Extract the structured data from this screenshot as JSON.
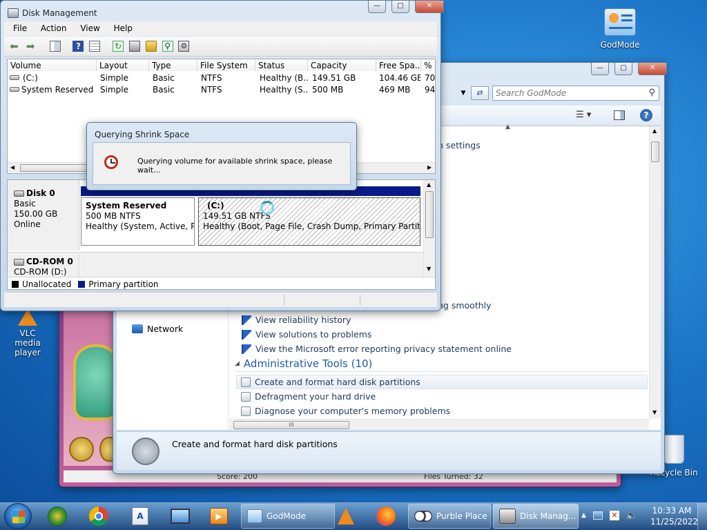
{
  "desktop": {
    "godmode_label": "GodMode",
    "vlc_label": "VLC media player",
    "recycle_label": "Recycle Bin"
  },
  "purble": {
    "score": "Score: 200",
    "turned": "Files Turned: 32"
  },
  "control_panel": {
    "search_placeholder": "Search GodMode",
    "partial_text_1": "n settings",
    "partial_text_2": "ng smoothly",
    "sidebar_network": "Network",
    "links": [
      "View reliability history",
      "View solutions to problems",
      "View the Microsoft error reporting privacy statement online"
    ],
    "section_title": "Administrative Tools (10)",
    "admin_links": [
      "Create and format hard disk partitions",
      "Defragment your hard drive",
      "Diagnose your computer's memory problems"
    ],
    "hscroll_grip": "III",
    "details_text": "Create and format hard disk partitions"
  },
  "disk_mgmt": {
    "title": "Disk Management",
    "menu": [
      "File",
      "Action",
      "View",
      "Help"
    ],
    "columns": [
      "Volume",
      "Layout",
      "Type",
      "File System",
      "Status",
      "Capacity",
      "Free Spa...",
      "% F"
    ],
    "rows": [
      [
        "(C:)",
        "Simple",
        "Basic",
        "NTFS",
        "Healthy (B...",
        "149.51 GB",
        "104.46 GB",
        "70"
      ],
      [
        "System Reserved",
        "Simple",
        "Basic",
        "NTFS",
        "Healthy (S...",
        "500 MB",
        "469 MB",
        "94"
      ]
    ],
    "disk0": {
      "name": "Disk 0",
      "type": "Basic",
      "size": "150.00 GB",
      "status": "Online",
      "partitions": [
        {
          "name": "System Reserved",
          "size": "500 MB NTFS",
          "status": "Healthy (System, Active, Prim"
        },
        {
          "name": "(C:)",
          "size": "149.51 GB NTFS",
          "status": "Healthy (Boot, Page File, Crash Dump, Primary Partition)"
        }
      ]
    },
    "cdrom": {
      "name": "CD-ROM 0",
      "drive": "CD-ROM (D:)"
    },
    "legend": [
      "Unallocated",
      "Primary partition"
    ]
  },
  "dialog": {
    "title": "Querying Shrink Space",
    "message": "Querying volume for available shrink space, please wait..."
  },
  "taskbar": {
    "tasks": [
      "GodMode",
      "Purble Place",
      "Disk Manag..."
    ],
    "time": "10:33 AM",
    "date": "11/25/2022"
  },
  "colors": {
    "primary_partition": "#0a1a8a",
    "unallocated": "#000000",
    "link": "#1e395b",
    "section": "#1e5aa8"
  }
}
